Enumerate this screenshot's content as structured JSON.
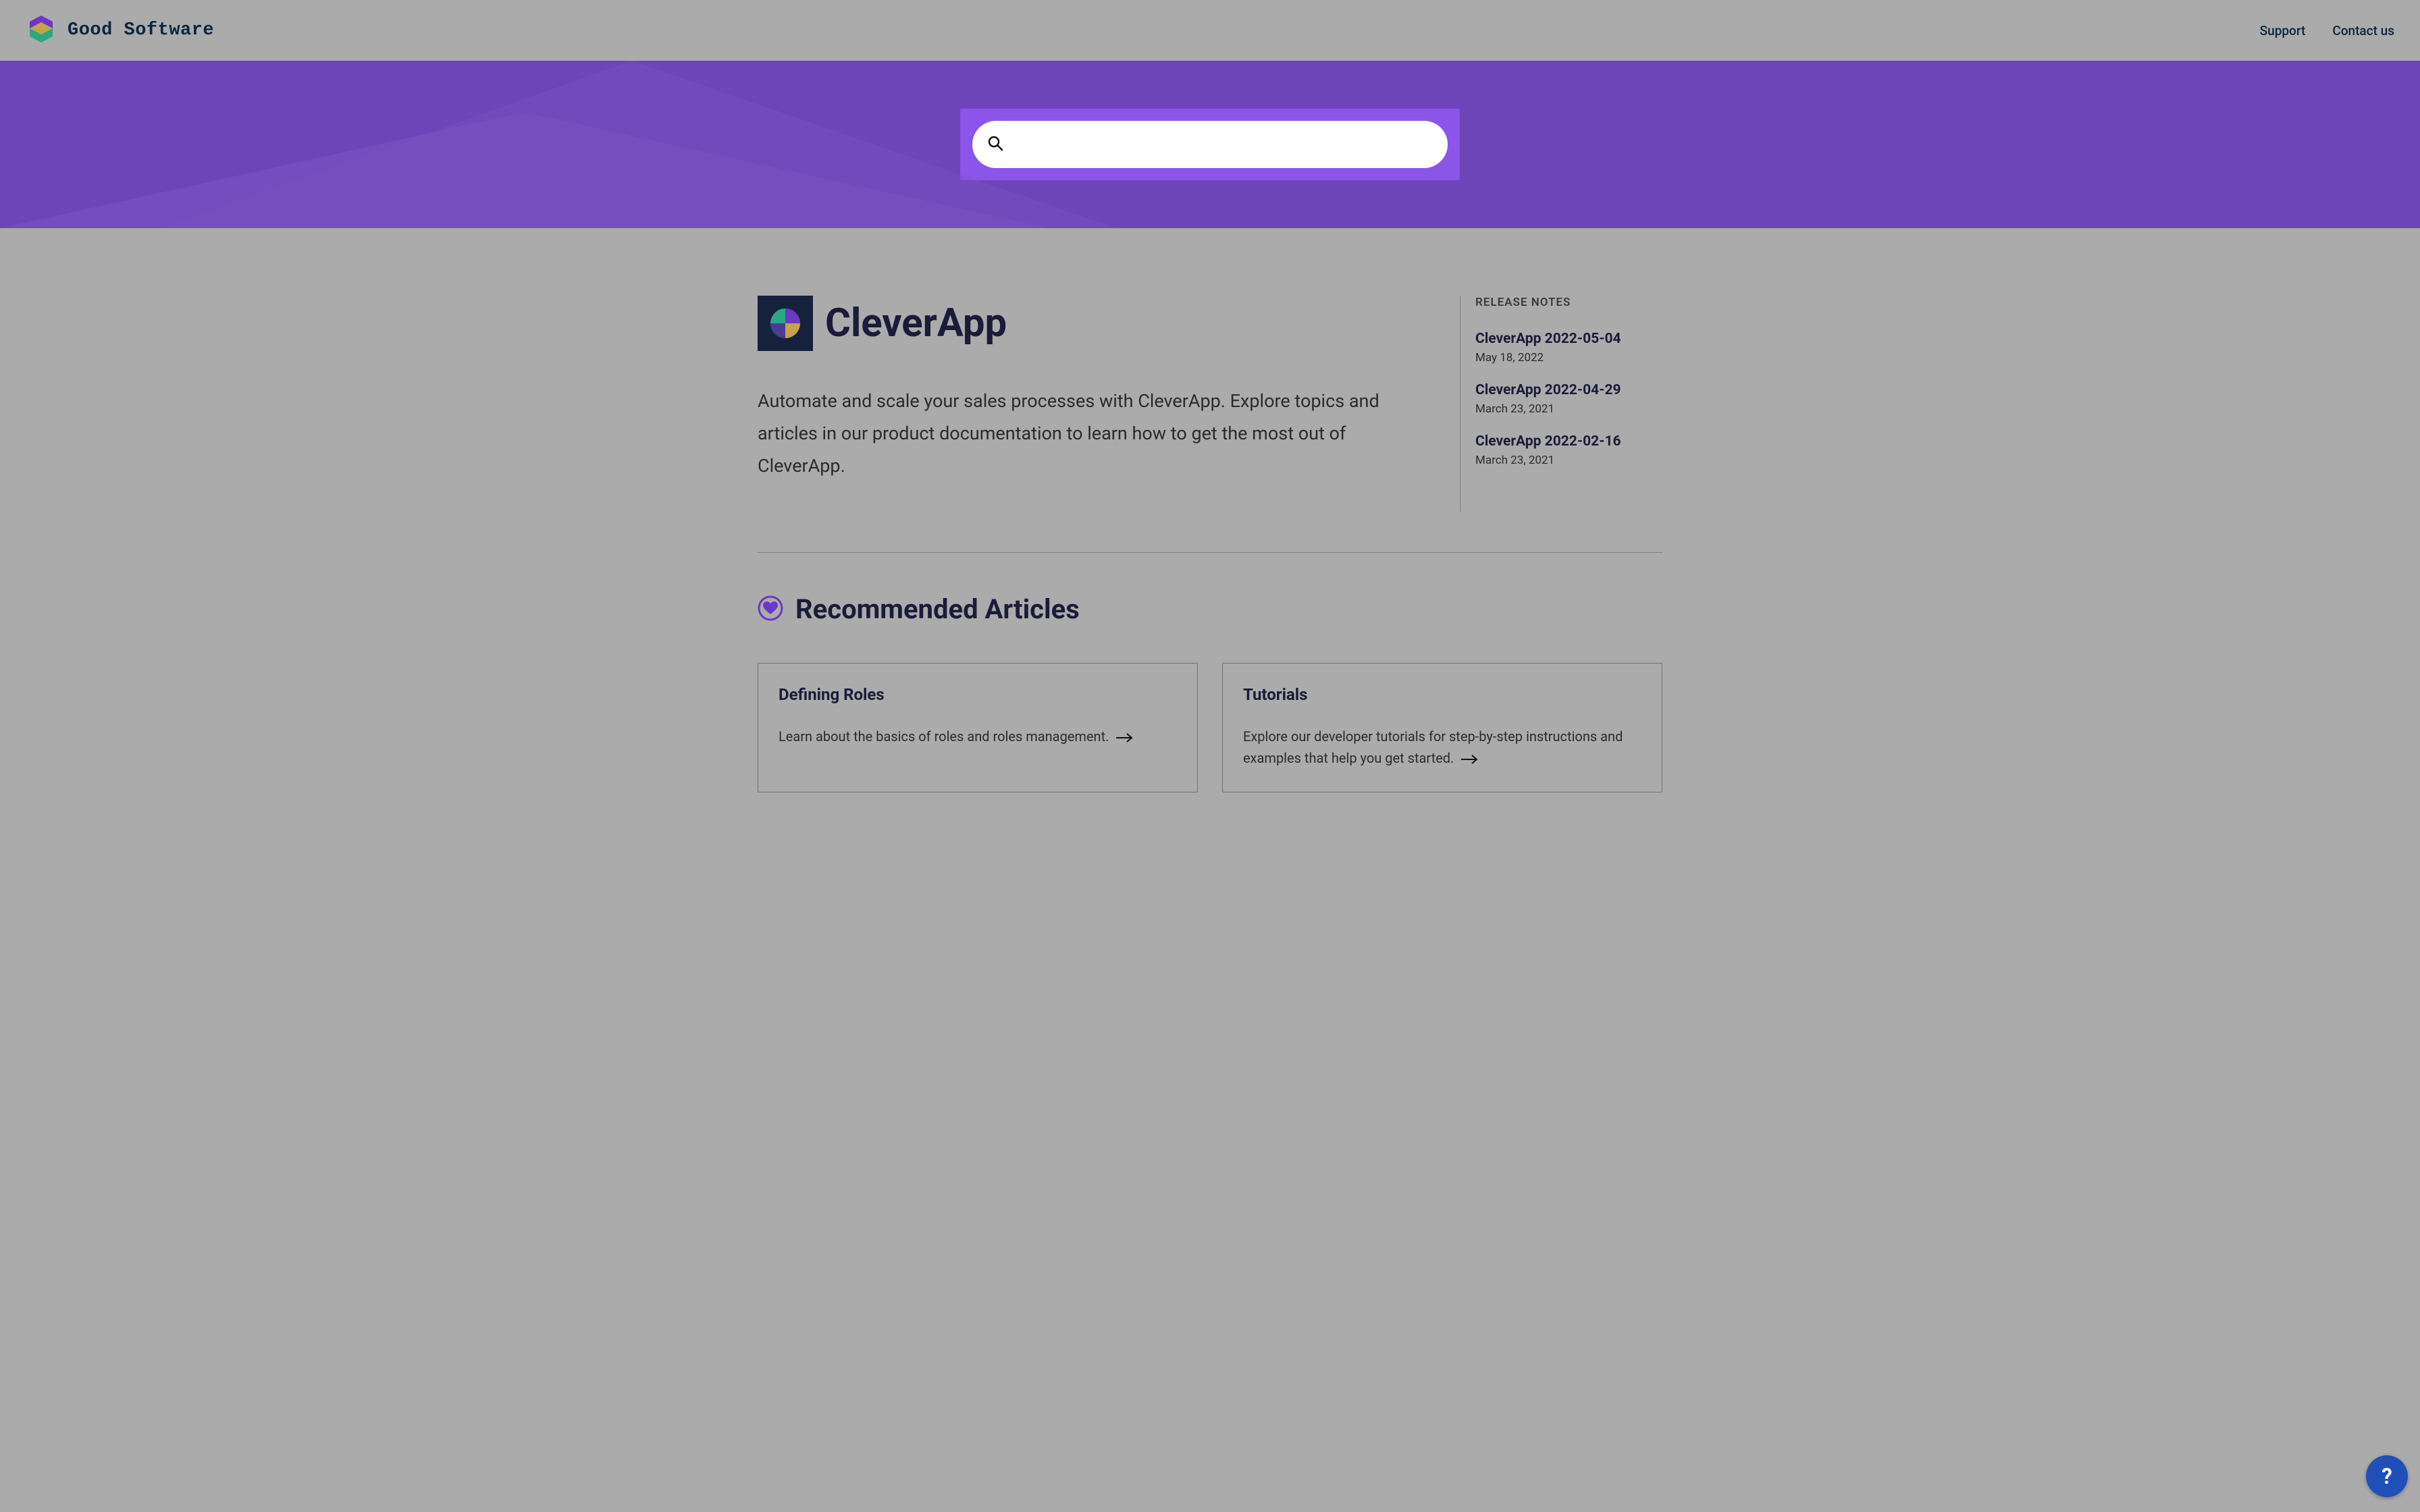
{
  "header": {
    "brand_name": "Good Software",
    "links": {
      "support": "Support",
      "contact": "Contact us"
    }
  },
  "search": {
    "placeholder": ""
  },
  "product": {
    "title": "CleverApp",
    "description": "Automate and scale your sales processes with CleverApp. Explore topics and articles in our product documentation to learn how to get the most out of CleverApp."
  },
  "release_notes": {
    "heading": "RELEASE NOTES",
    "items": [
      {
        "title": "CleverApp 2022-05-04",
        "date": "May 18, 2022"
      },
      {
        "title": "CleverApp 2022-04-29",
        "date": "March 23, 2021"
      },
      {
        "title": "CleverApp 2022-02-16",
        "date": "March 23, 2021"
      }
    ]
  },
  "recommended": {
    "heading": "Recommended Articles",
    "cards": [
      {
        "title": "Defining Roles",
        "body": "Learn about the basics of roles and roles management."
      },
      {
        "title": "Tutorials",
        "body": "Explore our developer tutorials for step-by-step instructions and examples that help you get started."
      }
    ]
  },
  "help": {
    "label": "?"
  },
  "colors": {
    "hero_bg": "#6d45b8",
    "search_wrap": "#8a55e8",
    "brand_text": "#0a2540",
    "accent_purple": "#6d37c7",
    "help_fab": "#1f4fb7"
  }
}
